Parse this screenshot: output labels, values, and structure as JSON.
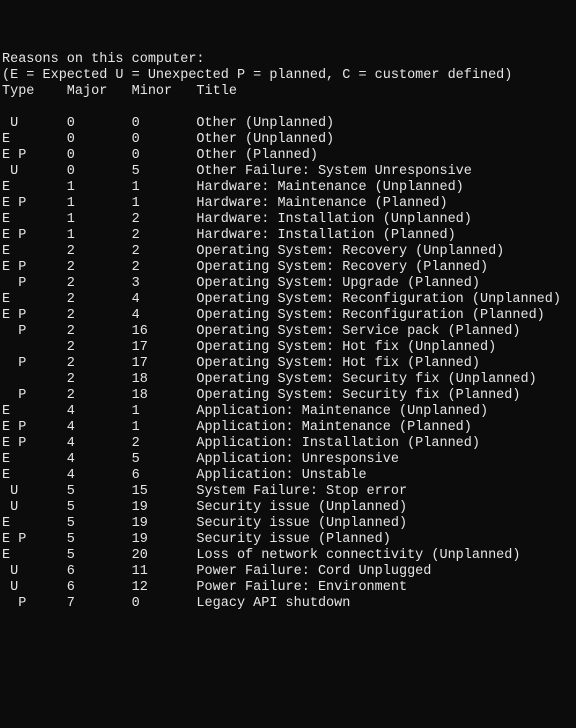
{
  "header": {
    "line1": "Reasons on this computer:",
    "line2": "(E = Expected U = Unexpected P = planned, C = customer defined)",
    "columns": "Type    Major   Minor   Title"
  },
  "columns": [
    "Type",
    "Major",
    "Minor",
    "Title"
  ],
  "rows": [
    {
      "type": " U",
      "major": "0",
      "minor": "0",
      "title": "Other (Unplanned)"
    },
    {
      "type": "E",
      "major": "0",
      "minor": "0",
      "title": "Other (Unplanned)"
    },
    {
      "type": "E P",
      "major": "0",
      "minor": "0",
      "title": "Other (Planned)"
    },
    {
      "type": " U",
      "major": "0",
      "minor": "5",
      "title": "Other Failure: System Unresponsive"
    },
    {
      "type": "E",
      "major": "1",
      "minor": "1",
      "title": "Hardware: Maintenance (Unplanned)"
    },
    {
      "type": "E P",
      "major": "1",
      "minor": "1",
      "title": "Hardware: Maintenance (Planned)"
    },
    {
      "type": "E",
      "major": "1",
      "minor": "2",
      "title": "Hardware: Installation (Unplanned)"
    },
    {
      "type": "E P",
      "major": "1",
      "minor": "2",
      "title": "Hardware: Installation (Planned)"
    },
    {
      "type": "E",
      "major": "2",
      "minor": "2",
      "title": "Operating System: Recovery (Unplanned)"
    },
    {
      "type": "E P",
      "major": "2",
      "minor": "2",
      "title": "Operating System: Recovery (Planned)"
    },
    {
      "type": "  P",
      "major": "2",
      "minor": "3",
      "title": "Operating System: Upgrade (Planned)"
    },
    {
      "type": "E",
      "major": "2",
      "minor": "4",
      "title": "Operating System: Reconfiguration (Unplanned)"
    },
    {
      "type": "E P",
      "major": "2",
      "minor": "4",
      "title": "Operating System: Reconfiguration (Planned)"
    },
    {
      "type": "  P",
      "major": "2",
      "minor": "16",
      "title": "Operating System: Service pack (Planned)"
    },
    {
      "type": "",
      "major": "2",
      "minor": "17",
      "title": "Operating System: Hot fix (Unplanned)"
    },
    {
      "type": "  P",
      "major": "2",
      "minor": "17",
      "title": "Operating System: Hot fix (Planned)"
    },
    {
      "type": "",
      "major": "2",
      "minor": "18",
      "title": "Operating System: Security fix (Unplanned)"
    },
    {
      "type": "  P",
      "major": "2",
      "minor": "18",
      "title": "Operating System: Security fix (Planned)"
    },
    {
      "type": "E",
      "major": "4",
      "minor": "1",
      "title": "Application: Maintenance (Unplanned)"
    },
    {
      "type": "E P",
      "major": "4",
      "minor": "1",
      "title": "Application: Maintenance (Planned)"
    },
    {
      "type": "E P",
      "major": "4",
      "minor": "2",
      "title": "Application: Installation (Planned)"
    },
    {
      "type": "E",
      "major": "4",
      "minor": "5",
      "title": "Application: Unresponsive"
    },
    {
      "type": "E",
      "major": "4",
      "minor": "6",
      "title": "Application: Unstable"
    },
    {
      "type": " U",
      "major": "5",
      "minor": "15",
      "title": "System Failure: Stop error"
    },
    {
      "type": " U",
      "major": "5",
      "minor": "19",
      "title": "Security issue (Unplanned)"
    },
    {
      "type": "E",
      "major": "5",
      "minor": "19",
      "title": "Security issue (Unplanned)"
    },
    {
      "type": "E P",
      "major": "5",
      "minor": "19",
      "title": "Security issue (Planned)"
    },
    {
      "type": "E",
      "major": "5",
      "minor": "20",
      "title": "Loss of network connectivity (Unplanned)"
    },
    {
      "type": " U",
      "major": "6",
      "minor": "11",
      "title": "Power Failure: Cord Unplugged"
    },
    {
      "type": " U",
      "major": "6",
      "minor": "12",
      "title": "Power Failure: Environment"
    },
    {
      "type": "  P",
      "major": "7",
      "minor": "0",
      "title": "Legacy API shutdown"
    }
  ]
}
